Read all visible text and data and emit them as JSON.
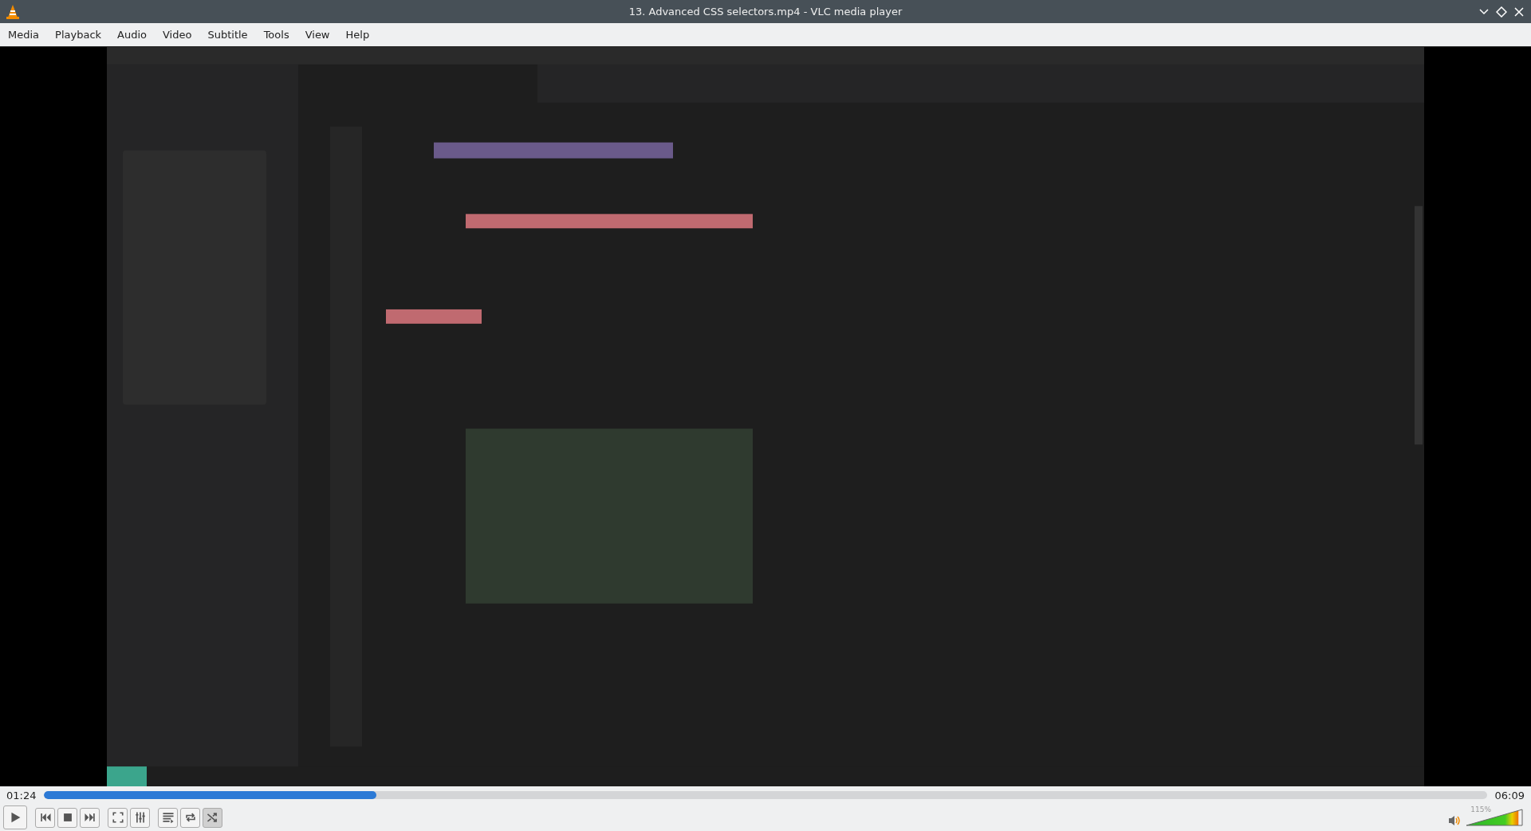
{
  "window": {
    "title": "13. Advanced CSS selectors.mp4 - VLC media player"
  },
  "menu": [
    "Media",
    "Playback",
    "Audio",
    "Video",
    "Subtitle",
    "Tools",
    "View",
    "Help"
  ],
  "video": {
    "kind": "picture"
  },
  "seek": {
    "elapsed": "01:24",
    "total": "06:09",
    "level": 0.23
  },
  "controls": [
    {
      "kind": "play",
      "selected": false
    },
    {
      "kind": "prev",
      "selected": false
    },
    {
      "kind": "stop",
      "selected": false
    },
    {
      "kind": "next",
      "selected": false
    },
    {
      "kind": "fullscreen",
      "selected": false
    },
    {
      "kind": "extended",
      "selected": false
    },
    {
      "kind": "playlist",
      "selected": false
    },
    {
      "kind": "loop",
      "selected": false
    },
    {
      "kind": "shuffle",
      "selected": true
    }
  ],
  "volume": {
    "reading": "115%",
    "level": 0.92
  }
}
